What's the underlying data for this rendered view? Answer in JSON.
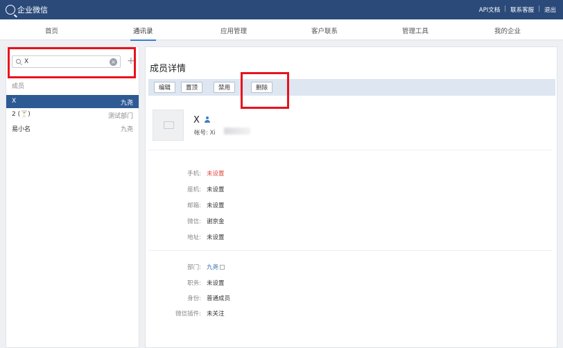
{
  "header": {
    "logo": "企业微信",
    "links": [
      "API文档",
      "联系客服",
      "退出"
    ]
  },
  "nav": {
    "items": [
      "首页",
      "通讯录",
      "应用管理",
      "客户联系",
      "管理工具",
      "我的企业"
    ],
    "active": "通讯录"
  },
  "sidebar": {
    "search_value": "X",
    "section_label": "成员",
    "members": [
      {
        "name": "X",
        "dept": "九尧",
        "selected": true
      },
      {
        "name": "2 (🍸)",
        "dept": "测试部门",
        "selected": false
      },
      {
        "name": "易小名",
        "dept": "九尧",
        "selected": false
      }
    ]
  },
  "detail": {
    "title": "成员详情",
    "toolbar": [
      "编辑",
      "置顶",
      "禁用",
      "删除"
    ],
    "user_name": "X",
    "account_label": "帐号: Xi",
    "contact": [
      {
        "label": "手机:",
        "value": "未设置",
        "highlight": true
      },
      {
        "label": "座机:",
        "value": "未设置"
      },
      {
        "label": "邮箱:",
        "value": "未设置"
      },
      {
        "label": "微信:",
        "value": "谢京金"
      },
      {
        "label": "地址:",
        "value": "未设置"
      }
    ],
    "org": [
      {
        "label": "部门:",
        "value": "九尧",
        "link": true
      },
      {
        "label": "职务:",
        "value": "未设置"
      },
      {
        "label": "身份:",
        "value": "普通成员"
      },
      {
        "label": "微信插件:",
        "value": "未关注"
      }
    ]
  },
  "colors": {
    "header_bg": "#2b4a7a",
    "selected_row": "#2e5a93",
    "annotation_red": "#e8121c",
    "toolbar_bg": "#dde6f1"
  }
}
